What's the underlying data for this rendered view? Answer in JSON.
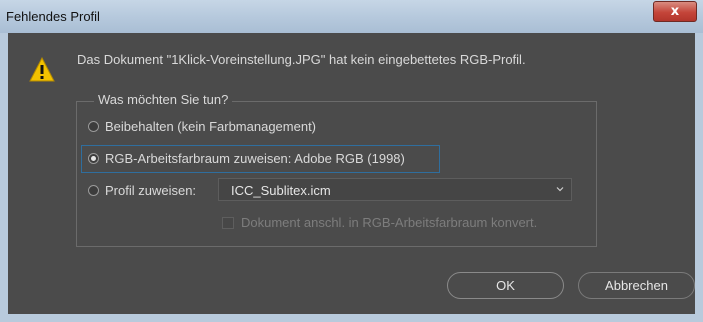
{
  "window": {
    "title": "Fehlendes Profil",
    "close_label": "x"
  },
  "message": "Das Dokument \"1Klick-Voreinstellung.JPG\" hat kein eingebettetes RGB-Profil.",
  "group": {
    "legend": "Was möchten Sie tun?",
    "options": [
      {
        "label": "Beibehalten (kein Farbmanagement)",
        "checked": false
      },
      {
        "label": "RGB-Arbeitsfarbraum zuweisen: Adobe RGB (1998)",
        "checked": true
      },
      {
        "label": "Profil zuweisen:",
        "checked": false
      }
    ],
    "profile_select": {
      "value": "ICC_Sublitex.icm"
    },
    "convert_checkbox": {
      "label": "Dokument anschl. in RGB-Arbeitsfarbraum konvert.",
      "checked": false,
      "enabled": false
    }
  },
  "buttons": {
    "ok": "OK",
    "cancel": "Abbrechen"
  },
  "icons": {
    "warning": "warning-icon",
    "close": "close-icon",
    "dropdown": "chevron-down-icon"
  },
  "colors": {
    "dialog_bg": "#4b4b4b",
    "title_bg": "#b5c8dc",
    "close_bg": "#c4453a",
    "focus": "#2f6e9e",
    "warning": "#f2c200"
  }
}
